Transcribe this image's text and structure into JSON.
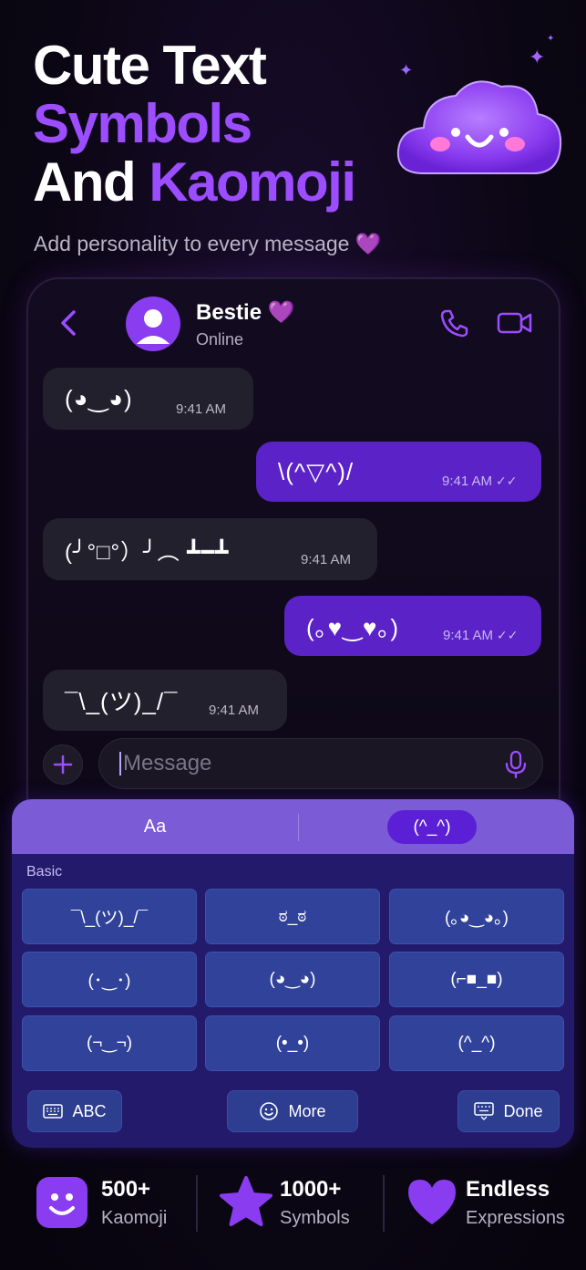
{
  "hero": {
    "title_line1": "Cute Text",
    "title_line2": "Symbols",
    "title_line3_white": "And ",
    "title_line3_purple": "Kaomoji",
    "subtitle": "Add personality to every message 💜"
  },
  "chat": {
    "contact_name": "Bestie 💜",
    "contact_status": "Online",
    "messages": [
      {
        "direction": "incoming",
        "text": "(◕‿◕)",
        "time": "9:41 AM"
      },
      {
        "direction": "outgoing",
        "text": "\\(^▽^)/",
        "time": "9:41 AM",
        "read": "✓✓"
      },
      {
        "direction": "incoming",
        "text": "(╯°□°）╯︵ ┻━┻",
        "time": "9:41 AM"
      },
      {
        "direction": "outgoing",
        "text": "(｡♥‿♥｡)",
        "time": "9:41 AM",
        "read": "✓✓"
      },
      {
        "direction": "incoming",
        "text": "¯\\_(ツ)_/¯",
        "time": "9:41 AM"
      }
    ],
    "input_placeholder": "Message"
  },
  "keyboard": {
    "tab_text": "Aa",
    "tab_kaomoji": "(^_^)",
    "section_label": "Basic",
    "keys": [
      "¯\\_(ツ)_/¯",
      "ಠ_ಠ",
      "(｡◕‿◕｡)",
      "(･‿･)",
      "(◕‿◕)",
      "(⌐■_■)",
      "(¬‿¬)",
      "(•_•)",
      "(^_^)"
    ],
    "abc_label": "ABC",
    "more_label": "More",
    "done_label": "Done"
  },
  "stats": [
    {
      "value": "500+",
      "label": "Kaomoji",
      "icon": "smiley-icon"
    },
    {
      "value": "1000+",
      "label": "Symbols",
      "icon": "star-icon"
    },
    {
      "value": "Endless",
      "label": "Expressions",
      "icon": "heart-icon"
    }
  ],
  "colors": {
    "accent": "#9b4dff",
    "outgoing_bubble": "#5b22c7",
    "incoming_bubble": "#23202d",
    "keyboard_bg": "#241a6b",
    "key_bg": "#30429a"
  }
}
